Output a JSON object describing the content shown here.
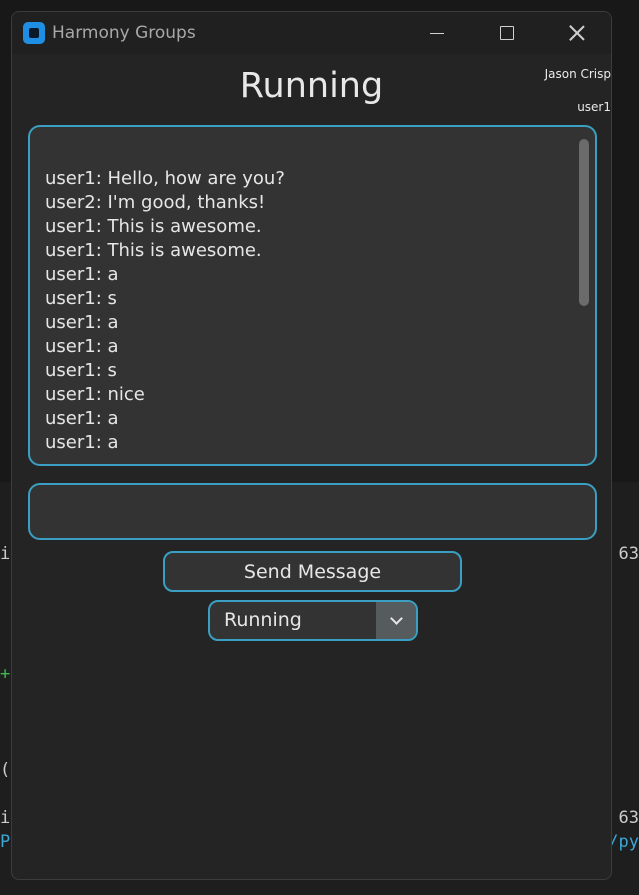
{
  "window": {
    "title": "Harmony Groups"
  },
  "header": {
    "title": "Running",
    "user_name": "Jason Crisp",
    "user_id": "user1"
  },
  "chat": {
    "messages": [
      "user1: Hello, how are you?",
      "user2: I'm good, thanks!",
      "user1: This is awesome.",
      "user1: This is awesome.",
      "user1: a",
      "user1: s",
      "user1: a",
      "user1: a",
      "user1: s",
      "user1: nice",
      "user1: a",
      "user1: a"
    ]
  },
  "composer": {
    "value": "",
    "send_label": "Send Message"
  },
  "status_select": {
    "selected": "Running"
  },
  "background": {
    "fragments": [
      {
        "text": "i(",
        "side": "left",
        "top": "row1"
      },
      {
        "text": "63",
        "side": "right",
        "top": "row1"
      },
      {
        "text": "+",
        "side": "left",
        "top": "row2"
      },
      {
        "text": "(",
        "side": "left",
        "top": "row3"
      },
      {
        "text": "i(",
        "side": "left",
        "top": "row4"
      },
      {
        "text": "63",
        "side": "right",
        "top": "row4"
      },
      {
        "text": "P",
        "side": "left",
        "top": "row5"
      },
      {
        "text": "/py",
        "side": "right",
        "top": "row5"
      }
    ]
  },
  "colors": {
    "accent": "#3a9fc2",
    "window_bg": "#242424",
    "field_bg": "#333333"
  }
}
